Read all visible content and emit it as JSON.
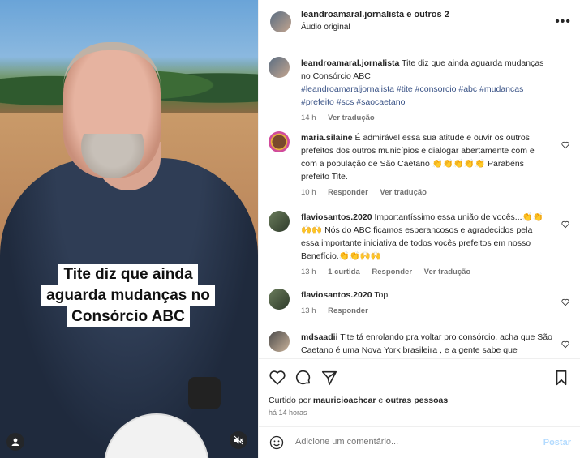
{
  "media": {
    "caption_lines": [
      "Tite diz que ainda",
      "aguarda mudanças no",
      "Consórcio ABC"
    ]
  },
  "header": {
    "author_line": "leandroamaral.jornalista e outros 2",
    "audio_label": "Áudio original",
    "more_glyph": "•••"
  },
  "caption": {
    "user": "leandroamaral.jornalista",
    "text": "Tite diz que ainda aguarda mudanças no Consórcio ABC",
    "tags": "#leandroamaraljornalista #tite #consorcio #abc #mudancas #prefeito #scs #saocaetano",
    "time": "14 h",
    "translate": "Ver tradução"
  },
  "comments": [
    {
      "user": "maria.silaine",
      "text": "É admirável essa sua atitude e ouvir os outros prefeitos dos outros municípios e dialogar abertamente com e com a população de São Caetano 👏👏👏👏👏 Parabéns prefeito Tite.",
      "time": "10 h",
      "reply": "Responder",
      "translate": "Ver tradução"
    },
    {
      "user": "flaviosantos.2020",
      "text": "Importantíssimo essa união de vocês...👏👏🙌🙌 Nós do ABC ficamos esperancosos e agradecidos pela essa importante iniciativa de todos vocês prefeitos em nosso Benefício.👏👏🙌🙌",
      "time": "13 h",
      "likes": "1 curtida",
      "reply": "Responder",
      "translate": "Ver tradução"
    },
    {
      "user": "flaviosantos.2020",
      "text": "Top",
      "time": "13 h",
      "reply": "Responder"
    },
    {
      "user": "mdsaadii",
      "text": "Tite tá enrolando pra voltar pro consórcio, acha que São Caetano é uma Nova York brasileira , e a gente sabe que"
    }
  ],
  "likes": {
    "prefix": "Curtido por",
    "user": "mauricioachcar",
    "middle": "e",
    "others": "outras pessoas",
    "time": "há 14 horas"
  },
  "add_comment": {
    "placeholder": "Adicione um comentário...",
    "post_label": "Postar"
  },
  "colors": {
    "link_blue": "#385185",
    "post_disabled": "#b3dbff",
    "muted_text": "#737373"
  }
}
